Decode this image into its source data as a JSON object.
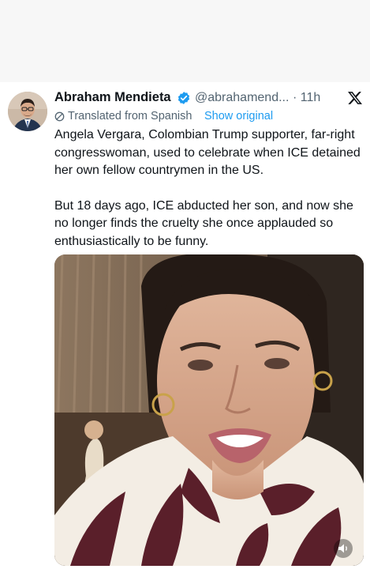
{
  "tweet": {
    "author_name": "Abraham Mendieta",
    "handle": "@abrahamend...",
    "time": "· 11h",
    "translated_label": "Translated from Spanish",
    "show_original_label": "Show original",
    "paragraphs": [
      "Angela Vergara, Colombian Trump supporter, far-right congresswoman, used to celebrate when ICE detained her own fellow countrymen in the US.",
      "But 18 days ago, ICE abducted her son, and now she no longer finds the cruelty she once applauded so enthusiastically to be funny."
    ]
  },
  "icons": {
    "verified": "verified-badge-icon",
    "platform": "x-logo-icon",
    "translate": "globe-icon",
    "volume": "volume-icon"
  },
  "colors": {
    "link": "#1d9bf0",
    "secondary_text": "#536471",
    "primary_text": "#0f1419"
  }
}
